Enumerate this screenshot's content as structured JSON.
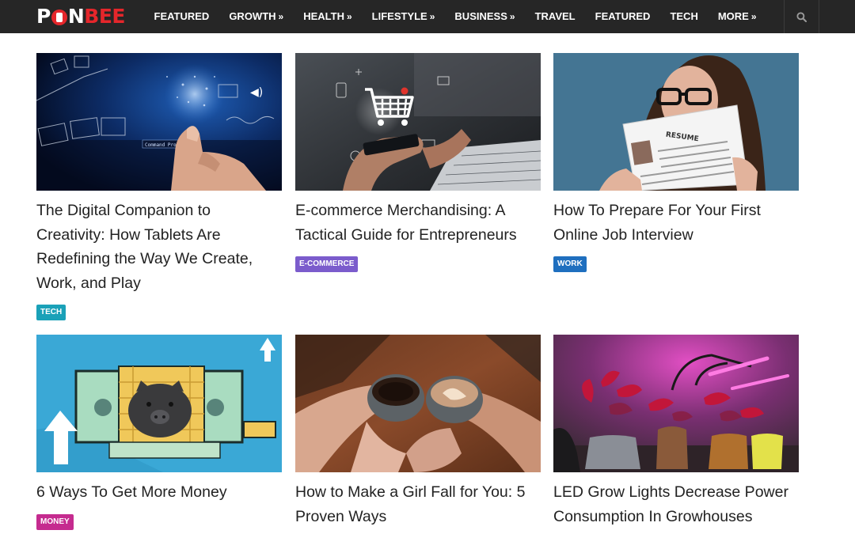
{
  "header": {
    "logo_text": "PONBEE",
    "nav": [
      {
        "label": "FEATURED",
        "has_arrow": false
      },
      {
        "label": "GROWTH",
        "has_arrow": true
      },
      {
        "label": "HEALTH",
        "has_arrow": true
      },
      {
        "label": "LIFESTYLE",
        "has_arrow": true
      },
      {
        "label": "BUSINESS",
        "has_arrow": true
      },
      {
        "label": "TRAVEL",
        "has_arrow": false
      },
      {
        "label": "FEATURED",
        "has_arrow": false
      },
      {
        "label": "TECH",
        "has_arrow": false
      },
      {
        "label": "MORE",
        "has_arrow": true
      }
    ],
    "search_icon": "search-icon"
  },
  "colors": {
    "header_bg": "#262626",
    "brand_red": "#e5262b",
    "tech": "#1aa1b8",
    "ecommerce": "#7b5ccc",
    "work": "#1f6fbf",
    "money": "#c52b8f"
  },
  "articles": [
    {
      "title": "The Digital Companion to Creativity: How Tablets Are Redefining the Way We Create, Work, and Play",
      "category": "TECH",
      "category_color": "#1aa1b8",
      "image": "hand-touching-digital-brain-image",
      "image_text": "Command Prompt"
    },
    {
      "title": "E-commerce Merchandising: A Tactical Guide for Entrepreneurs",
      "category": "E-COMMERCE",
      "category_color": "#7b5ccc",
      "image": "phone-shopping-cart-image"
    },
    {
      "title": "How To Prepare For Your First Online Job Interview",
      "category": "WORK",
      "category_color": "#1f6fbf",
      "image": "woman-holding-resume-image",
      "image_text": "RESUME"
    },
    {
      "title": "6 Ways To Get More Money",
      "category": "MONEY",
      "category_color": "#c52b8f",
      "image": "piggy-bank-illustration-image"
    },
    {
      "title": "How to Make a Girl Fall for You: 5 Proven Ways",
      "category": "",
      "category_color": "",
      "image": "couple-holding-coffee-cups-image"
    },
    {
      "title": "LED Grow Lights Decrease Power Consumption In Growhouses",
      "category": "",
      "category_color": "",
      "image": "plants-under-led-grow-light-image"
    }
  ]
}
